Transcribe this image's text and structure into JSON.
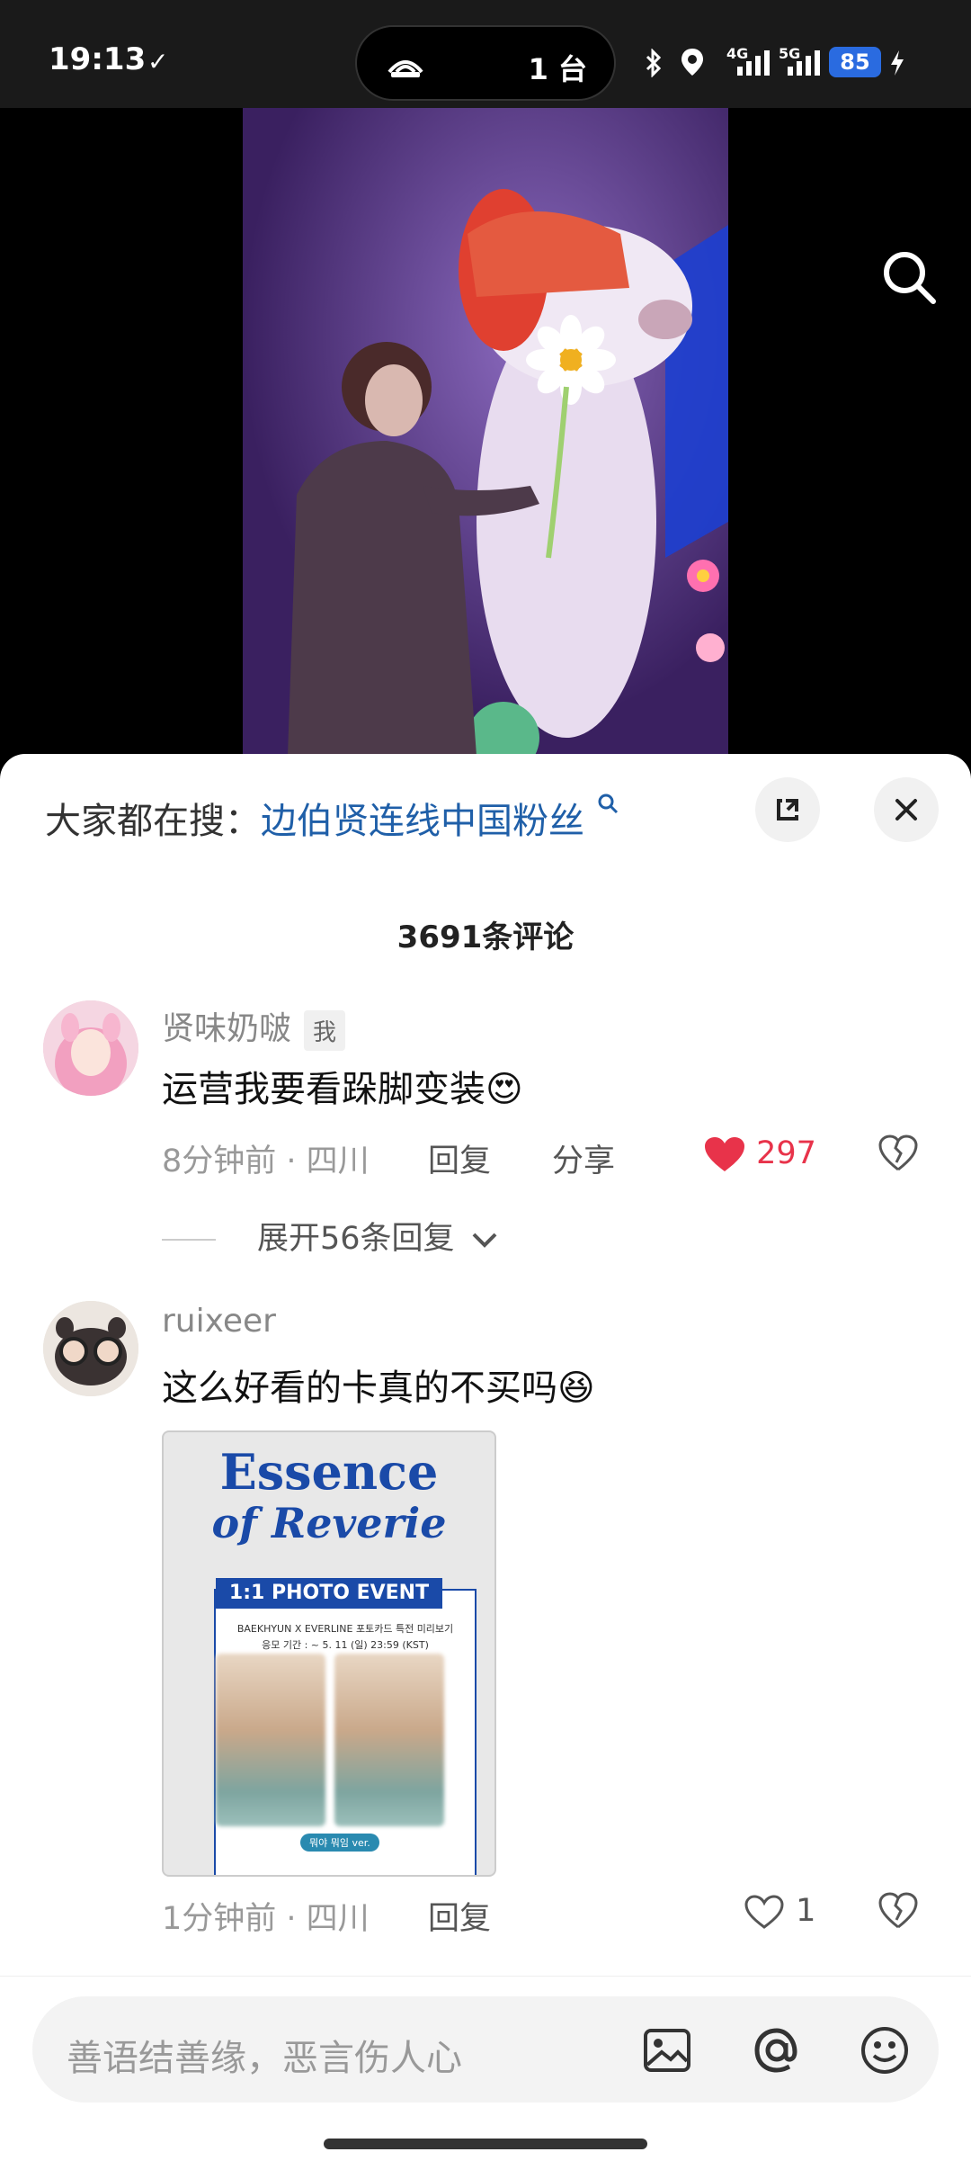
{
  "status_bar": {
    "time": "19:13",
    "check": "✓",
    "cast_devices": "1 台",
    "battery": "85",
    "net_4g": "4G",
    "net_5g": "5G"
  },
  "comments_sheet": {
    "hot_search_prefix": "大家都在搜：",
    "hot_search_keyword": "边伯贤连线中国粉丝",
    "comment_count": "3691条评论",
    "comments": [
      {
        "username": "贤味奶啵",
        "tag": "我",
        "text": "运营我要看跺脚变装",
        "emoji": "😍",
        "meta": "8分钟前 · 四川",
        "reply_label": "回复",
        "share_label": "分享",
        "likes": "297",
        "liked": true,
        "expand_label": "展开56条回复"
      },
      {
        "username": "ruixeer",
        "text": "这么好看的卡真的不买吗",
        "emoji": "😆",
        "image": {
          "title1": "Essence",
          "title2": "of Reverie",
          "banner": "1:1 PHOTO EVENT",
          "sub1": "BAEKHYUN X EVERLINE 포토카드 특전 미리보기",
          "sub2": "응모 기간 : ~ 5. 11 (일) 23:59 (KST)",
          "badge": "뭐야 뭐임 ver."
        },
        "meta": "1分钟前 · 四川",
        "reply_label": "回复",
        "likes": "1",
        "liked": false
      }
    ]
  },
  "input_bar": {
    "placeholder": "善语结善缘，恶言伤人心"
  },
  "colors": {
    "accent_red": "#e8334a",
    "keyword_blue": "#1f5fa8",
    "battery_blue": "#2a6be0"
  }
}
